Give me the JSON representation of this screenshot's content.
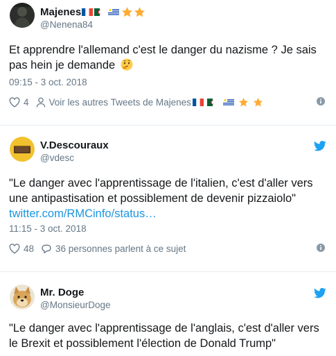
{
  "tweets": [
    {
      "name": "Majenes",
      "handle": "@Nenena84",
      "text": "Et apprendre l'allemand c'est le danger du nazisme ? Je sais pas hein je demande",
      "timestamp": "09:15 - 3 oct. 2018",
      "likes": "4",
      "secondary_action": "Voir les autres Tweets de Majenes"
    },
    {
      "name": "V.Descouraux",
      "handle": "@vdesc",
      "text": "\"Le danger avec l'apprentissage de l'italien, c'est d'aller vers une antipastisation et possiblement de devenir pizzaiolo\"",
      "link": "twitter.com/RMCinfo/status…",
      "timestamp": "11:15 - 3 oct. 2018",
      "likes": "48",
      "secondary_action": "36 personnes parlent à ce sujet"
    },
    {
      "name": "Mr. Doge",
      "handle": "@MonsieurDoge",
      "text": "\"Le danger avec l'apprentissage de l'anglais, c'est d'aller vers le Brexit et possiblement l'élection de Donald Trump\""
    }
  ],
  "colors": {
    "text": "#14171a",
    "muted": "#657786",
    "link": "#1b95e0",
    "divider": "#e6ecf0"
  },
  "icons": [
    "heart-icon",
    "person-icon",
    "speech-bubble-icon",
    "info-icon",
    "twitter-bird-icon",
    "thinking-face-emoji",
    "star-emoji"
  ]
}
